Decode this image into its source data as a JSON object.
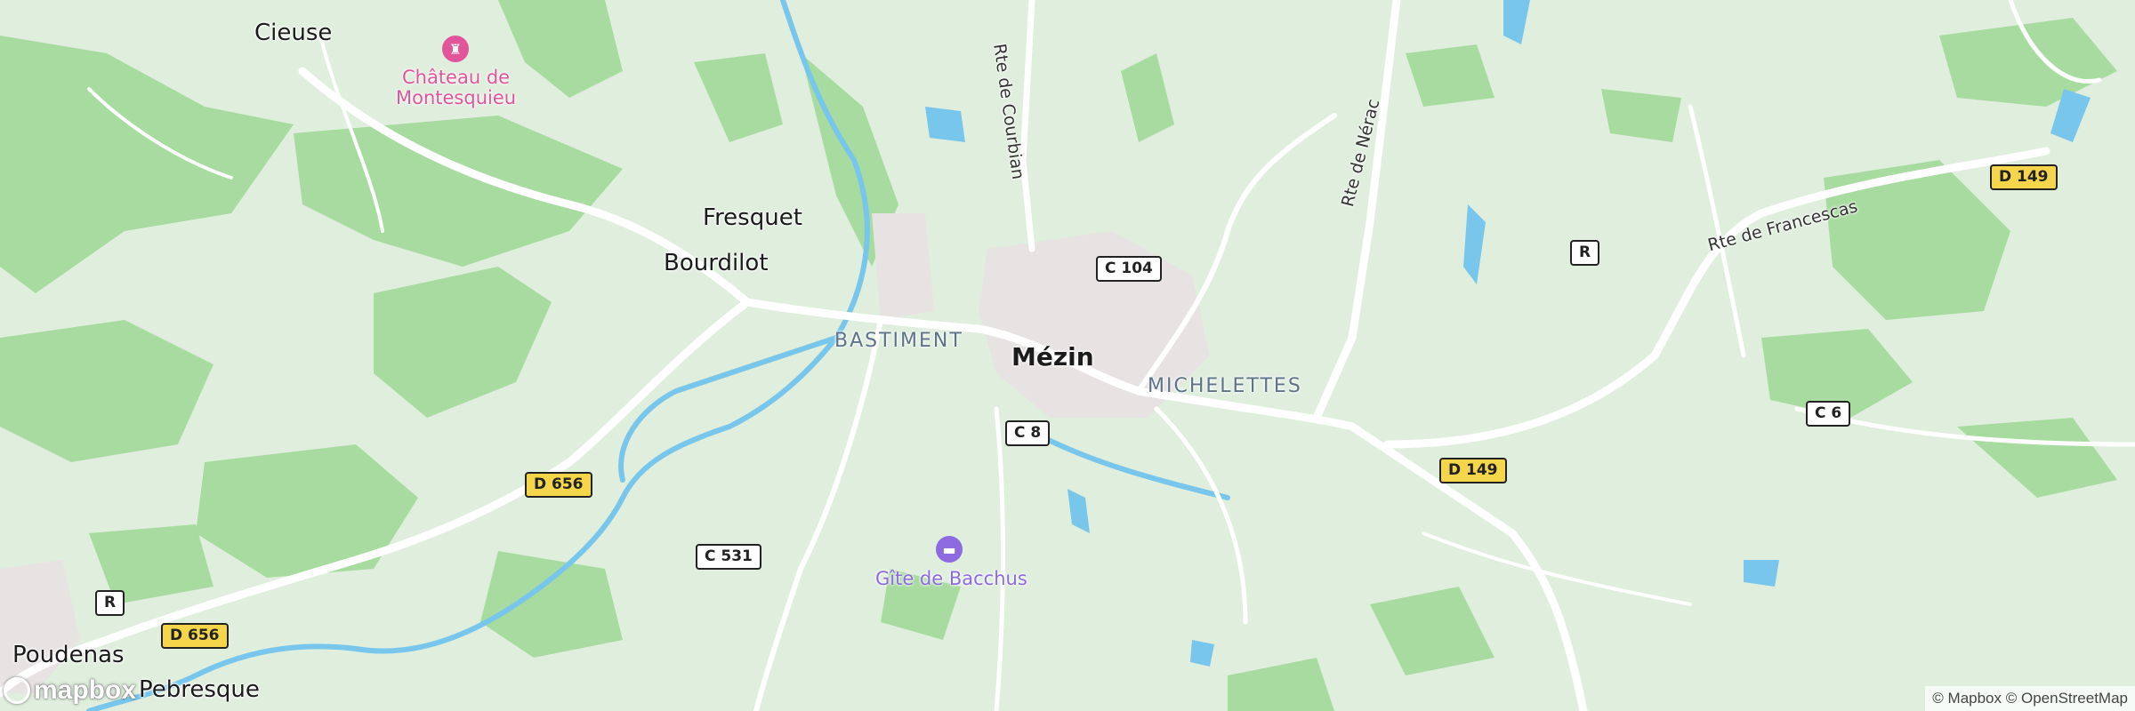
{
  "map": {
    "places": {
      "cieuse": "Cieuse",
      "fresquet": "Fresquet",
      "bourdilot": "Bourdilot",
      "mezin": "Mézin",
      "poudenas": "Poudenas",
      "pebresque": "Pebresque"
    },
    "districts": {
      "bastiment": "BASTIMENT",
      "michelettes": "MICHELETTES"
    },
    "pois": {
      "chateau": {
        "name_line1": "Château de",
        "name_line2": "Montesquieu",
        "color": "#e3559a",
        "icon": "castle-icon"
      },
      "gite": {
        "name": "Gîte de Bacchus",
        "color": "#8d6ae0",
        "icon": "bed-icon"
      }
    },
    "road_names": {
      "courbian": "Rte de Courbian",
      "nerac": "Rte de Nérac",
      "francescas": "Rte de Francescas"
    },
    "shields": {
      "d149_top": "D 149",
      "d149_mid": "D 149",
      "d656_mid": "D 656",
      "d656_low": "D 656",
      "c104": "C 104",
      "c8": "C 8",
      "c531": "C 531",
      "c6": "C 6",
      "r_right": "R",
      "r_left": "R"
    },
    "colors": {
      "land": "#dfeedd",
      "forest": "#a8dba0",
      "water": "#78c6ec",
      "road": "#ffffff",
      "urban": "#e8e3e3",
      "shield_yellow": "#f5d549"
    }
  },
  "branding": {
    "logo": "mapbox",
    "attribution": "© Mapbox © OpenStreetMap"
  }
}
